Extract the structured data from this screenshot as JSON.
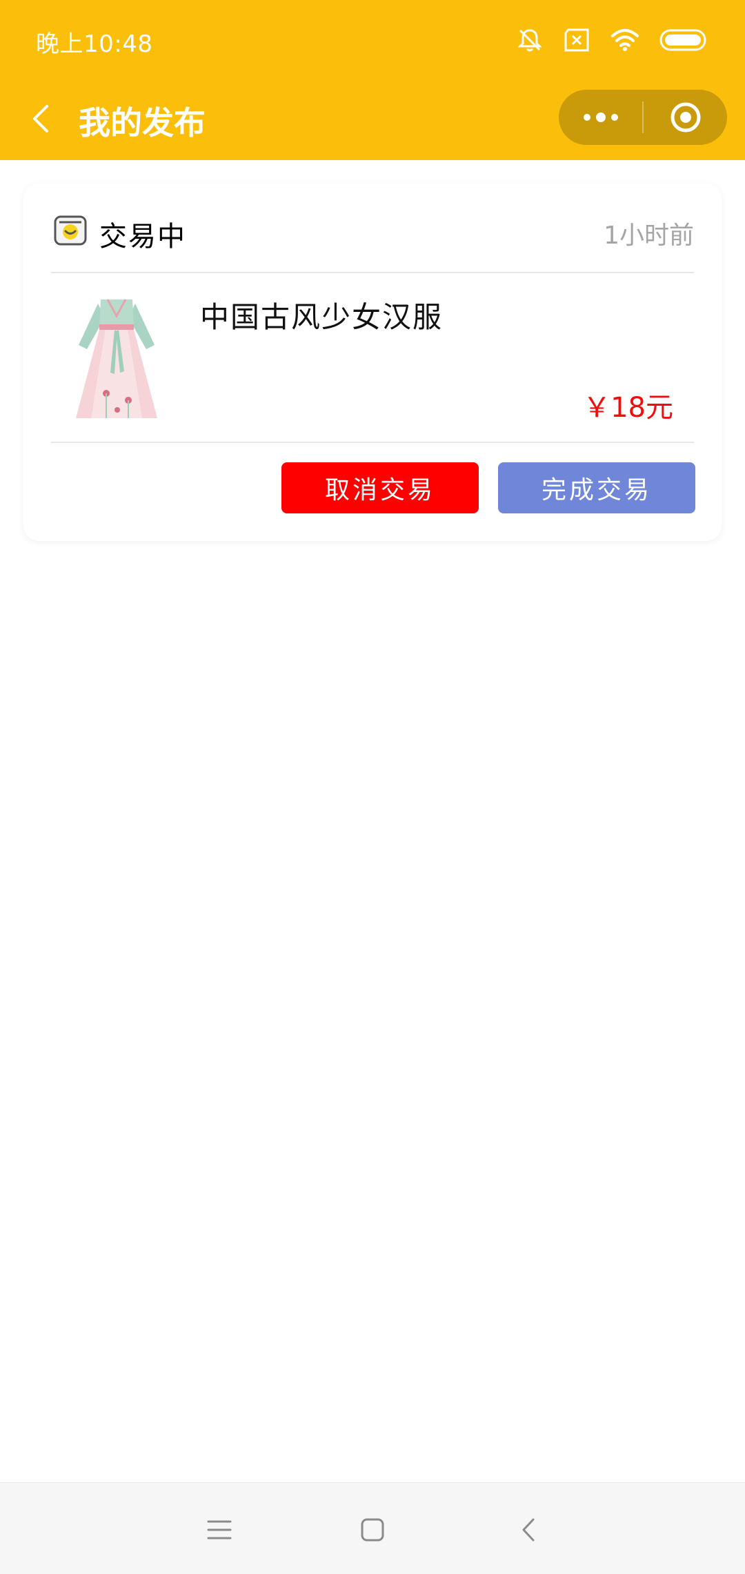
{
  "status_bar": {
    "time": "晚上10:48",
    "icons": [
      "bell-muted-icon",
      "sim-none-icon",
      "wifi-icon",
      "battery-icon"
    ]
  },
  "app_bar": {
    "title": "我的发布",
    "back_icon": "back-arrow-icon",
    "more_icon": "more-dots-icon",
    "close_icon": "target-circle-icon"
  },
  "colors": {
    "header": "#FBBE0A",
    "capsule": "#C99A09",
    "cancel_button": "#FF0000",
    "complete_button": "#6F86D9",
    "price": "#F20D0D"
  },
  "card": {
    "status_icon": "trade-bag-icon",
    "status": "交易中",
    "time_ago": "1小时前",
    "product": {
      "image": "hanfu-dress-image",
      "name": "中国古风少女汉服",
      "price": "￥18元"
    },
    "actions": {
      "cancel_label": "取消交易",
      "complete_label": "完成交易"
    }
  },
  "nav_bar": {
    "icons": [
      "menu-lines-icon",
      "home-square-icon",
      "back-chevron-icon"
    ]
  }
}
